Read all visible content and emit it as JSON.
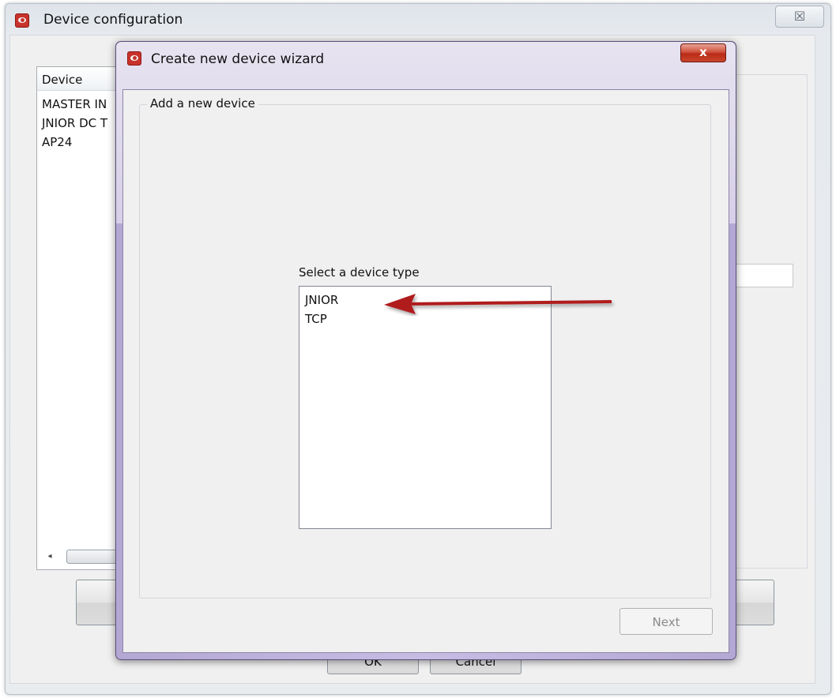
{
  "outer_window": {
    "title": "Device configuration",
    "close_glyph": "☒",
    "device_list": {
      "header": "Device",
      "rows": [
        "MASTER IN",
        "JNIOR DC T",
        "AP24"
      ]
    },
    "scroll_left_glyph": "◂",
    "ok_label": "OK",
    "cancel_label": "Cancel"
  },
  "wizard": {
    "title": "Create new device wizard",
    "close_glyph": "x",
    "group_label": "Add a new device",
    "select_label": "Select a device type",
    "device_types": [
      "JNIOR",
      "TCP"
    ],
    "next_label": "Next"
  },
  "colors": {
    "wizard_frame": "#b3a7d3",
    "close_red": "#c9462c",
    "arrow_red": "#b01e1e",
    "app_icon_red": "#c8322a"
  },
  "icons": {
    "app": "app-logo-icon",
    "arrow": "annotation-arrow"
  }
}
